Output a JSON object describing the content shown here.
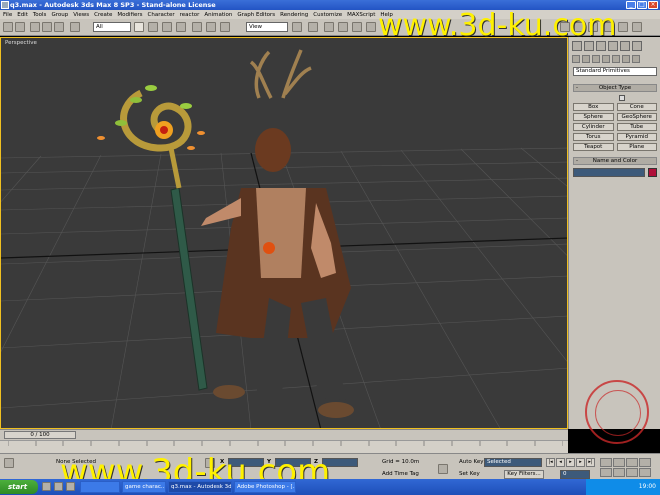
{
  "window": {
    "title": "q3.max - Autodesk 3ds Max 8 SP3  - Stand-alone License"
  },
  "menu": [
    "File",
    "Edit",
    "Tools",
    "Group",
    "Views",
    "Create",
    "Modifiers",
    "Character",
    "reactor",
    "Animation",
    "Graph Editors",
    "Rendering",
    "Customize",
    "MAXScript",
    "Help"
  ],
  "toolbar": {
    "filter": "All",
    "ref_coord": "View"
  },
  "viewport": {
    "label": "Perspective"
  },
  "watermark": {
    "text": "www.3d-ku.com"
  },
  "command_panel": {
    "category": "Standard Primitives",
    "object_type_title": "Object Type",
    "buttons": [
      "Box",
      "Cone",
      "Sphere",
      "GeoSphere",
      "Cylinder",
      "Tube",
      "Torus",
      "Pyramid",
      "Teapot",
      "Plane"
    ],
    "name_color_title": "Name and Color",
    "accent_color": "#b0103a"
  },
  "timeline": {
    "slider": "0 / 100"
  },
  "status": {
    "selection": "None Selected",
    "x_label": "X",
    "y_label": "Y",
    "z_label": "Z",
    "grid": "Grid = 10.0m",
    "add_time_tag": "Add Time Tag",
    "auto_key": "Auto Key",
    "set_key": "Set Key",
    "key_mode": "Selected",
    "key_filters": "Key Filters...",
    "frame": "0"
  },
  "taskbar": {
    "start": "start",
    "tasks": [
      "",
      "",
      "game charac...",
      "q3.max - Autodesk 3ds ...",
      "Adobe Photoshop - [..."
    ],
    "clock": "19:00"
  }
}
